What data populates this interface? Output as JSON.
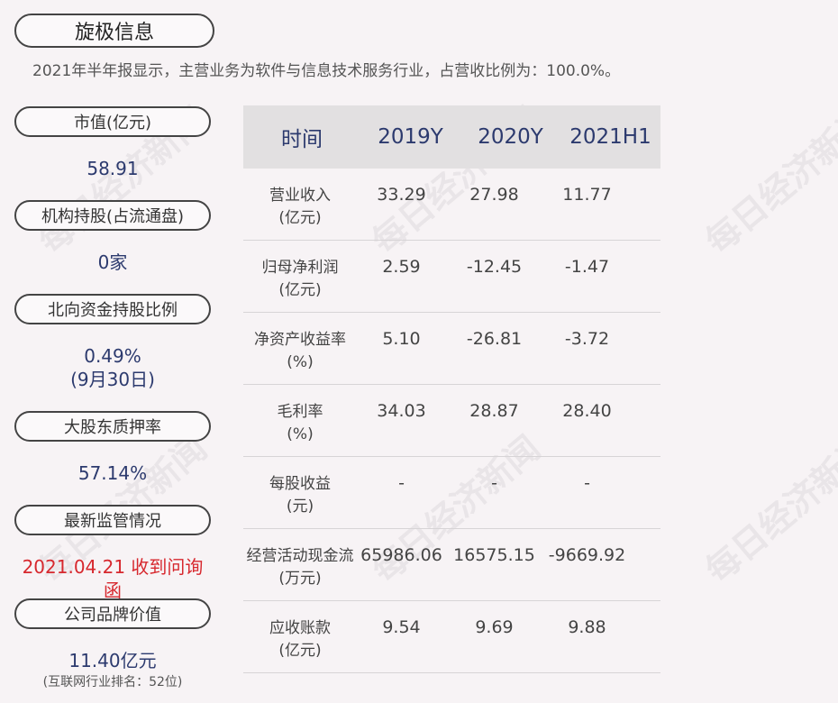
{
  "header": {
    "company": "旋极信息",
    "summary": "2021年半年报显示，主营业务为软件与信息技术服务行业，占营收比例为：100.0%。"
  },
  "side": {
    "market_cap_label": "市值(亿元)",
    "market_cap_value": "58.91",
    "institution_label": "机构持股(占流通盘)",
    "institution_value": "0家",
    "northbound_label": "北向资金持股比例",
    "northbound_value": "0.49%",
    "northbound_date": "(9月30日)",
    "pledge_label": "大股东质押率",
    "pledge_value": "57.14%",
    "regulation_label": "最新监管情况",
    "regulation_value": "2021.04.21 收到问询函",
    "brand_label": "公司品牌价值",
    "brand_value": "11.40亿元",
    "brand_note": "(互联网行业排名：52位)"
  },
  "table": {
    "headers": [
      "时间",
      "2019Y",
      "2020Y",
      "2021H1"
    ],
    "rows": [
      {
        "label1": "营业收入",
        "label2": "(亿元)",
        "v1": "33.29",
        "v2": "27.98",
        "v3": "11.77"
      },
      {
        "label1": "归母净利润",
        "label2": "(亿元)",
        "v1": "2.59",
        "v2": "-12.45",
        "v3": "-1.47"
      },
      {
        "label1": "净资产收益率",
        "label2": "(%)",
        "v1": "5.10",
        "v2": "-26.81",
        "v3": "-3.72"
      },
      {
        "label1": "毛利率",
        "label2": "(%)",
        "v1": "34.03",
        "v2": "28.87",
        "v3": "28.40"
      },
      {
        "label1": "每股收益",
        "label2": "(元)",
        "v1": "-",
        "v2": "-",
        "v3": "-"
      },
      {
        "label1": "经营活动现金流",
        "label2": "(万元)",
        "v1": "65986.06",
        "v2": "16575.15",
        "v3": "-9669.92"
      },
      {
        "label1": "应收账款",
        "label2": "(亿元)",
        "v1": "9.54",
        "v2": "9.69",
        "v3": "9.88"
      }
    ]
  },
  "watermark": "每日经济新闻",
  "colors": {
    "accent_blue": "#2c3a6e",
    "alert_red": "#d7282e",
    "background": "#f7f3f5"
  }
}
